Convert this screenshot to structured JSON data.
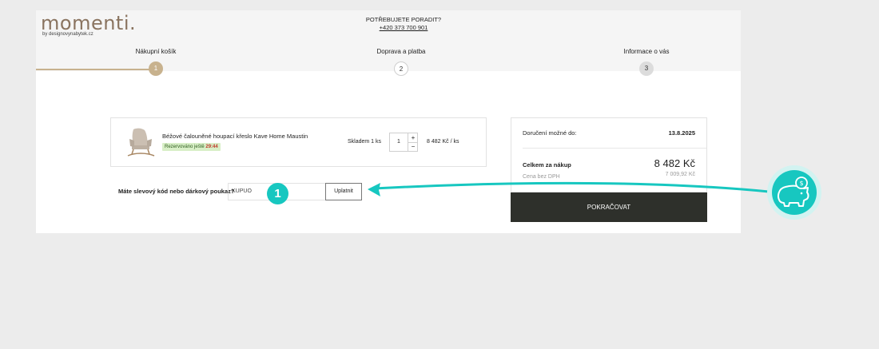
{
  "header": {
    "logo": "momenti.",
    "logo_sub": "by designovynabytek.cz",
    "help_title": "POTŘEBUJETE PORADIT?",
    "help_phone": "+420 373 700 901"
  },
  "steps": [
    {
      "label": "Nákupní košík",
      "number": "1"
    },
    {
      "label": "Doprava a platba",
      "number": "2"
    },
    {
      "label": "Informace o vás",
      "number": "3"
    }
  ],
  "cart": {
    "item": {
      "name": "Béžové čalouněné houpací křeslo Kave Home Maustin",
      "badge_text": "Rezervováno ještě",
      "badge_time": "29:44",
      "stock": "Skladem 1 ks",
      "quantity": "1",
      "plus": "+",
      "minus": "−",
      "price": "8 482 Kč  / ks"
    }
  },
  "coupon": {
    "label": "Máte slevový kód nebo dárkový poukaz?",
    "value": "KUPUO",
    "button": "Uplatnit"
  },
  "summary": {
    "delivery_label": "Doručení možné do:",
    "delivery_value": "13.8.2025",
    "total_label": "Celkem za nákup",
    "total_value": "8 482 Kč",
    "vat_label": "Cena bez DPH",
    "vat_value": "7 009,92 Kč",
    "continue": "POKRAČOVAT"
  },
  "annotation": {
    "badge_number": "1",
    "accent_color": "#17c7c0"
  }
}
